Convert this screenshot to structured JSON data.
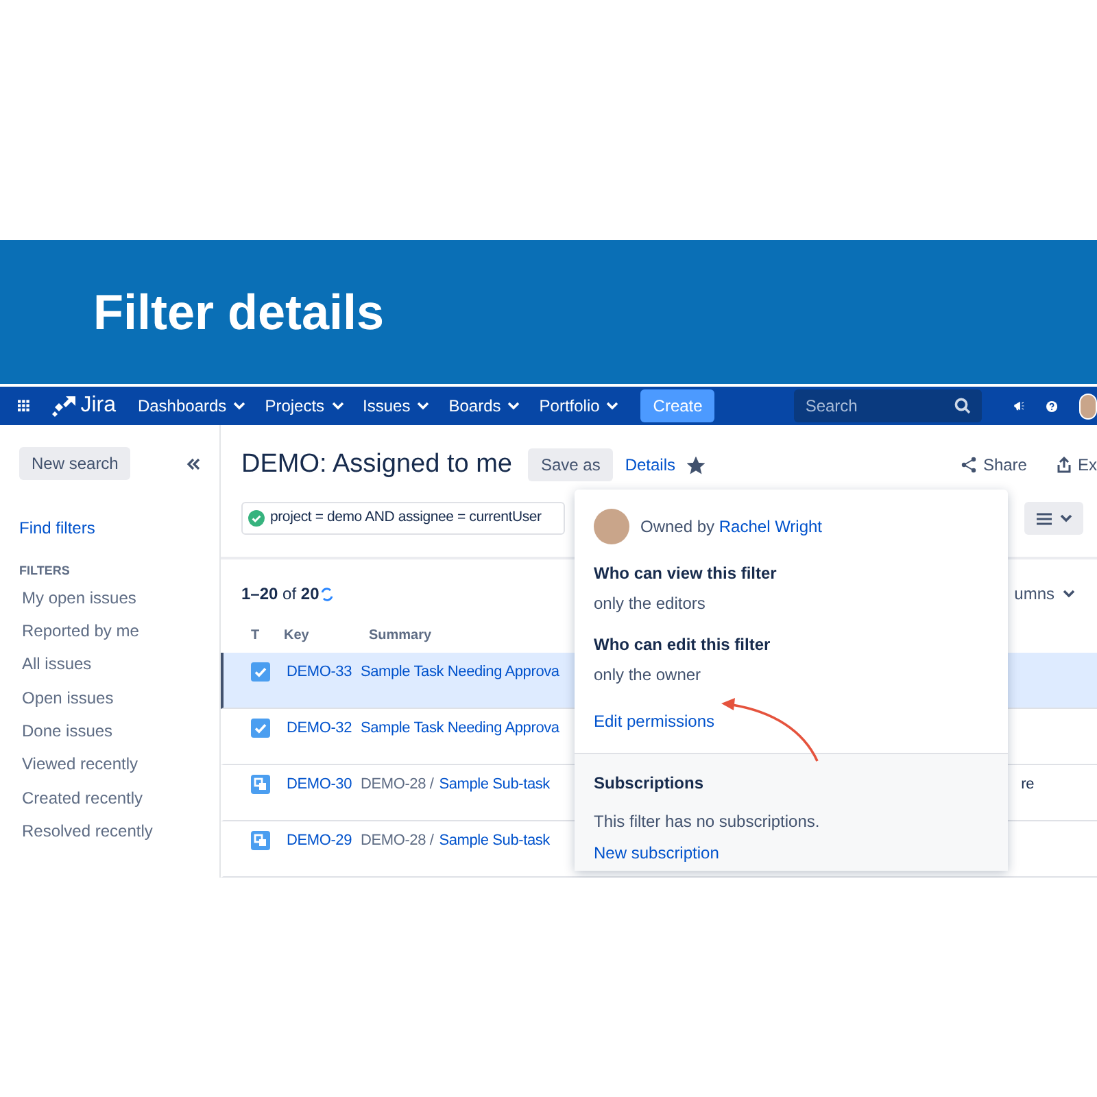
{
  "banner": {
    "title": "Filter details"
  },
  "nav": {
    "logo": "Jira",
    "menus": [
      "Dashboards",
      "Projects",
      "Issues",
      "Boards",
      "Portfolio"
    ],
    "create": "Create",
    "search": {
      "placeholder": "Search"
    }
  },
  "sidebar": {
    "new_search": "New search",
    "find_filters": "Find filters",
    "section": "FILTERS",
    "items": [
      "My open issues",
      "Reported by me",
      "All issues",
      "Open issues",
      "Done issues",
      "Viewed recently",
      "Created recently",
      "Resolved recently"
    ]
  },
  "filter": {
    "title": "DEMO: Assigned to me",
    "save_as": "Save as",
    "details": "Details",
    "starred": true,
    "share": "Share",
    "export": "Ex",
    "query": "project = demo AND assignee = currentUser",
    "query_valid": true
  },
  "results": {
    "count_range": "1–20",
    "count_of": "of",
    "count_total": "20",
    "columns_button": "umns"
  },
  "table": {
    "columns": [
      "T",
      "Key",
      "Summary"
    ],
    "rows": [
      {
        "kind": "task",
        "key": "DEMO-33",
        "summary": "Sample Task Needing Approva",
        "selected": true
      },
      {
        "kind": "task",
        "key": "DEMO-32",
        "summary": "Sample Task Needing Approva",
        "selected": false
      },
      {
        "kind": "subtask",
        "key": "DEMO-30",
        "parent": "DEMO-28 /",
        "summary": "Sample Sub-task",
        "column_4": "re",
        "selected": false
      },
      {
        "kind": "subtask",
        "key": "DEMO-29",
        "parent": "DEMO-28 /",
        "summary": "Sample Sub-task",
        "selected": false
      }
    ]
  },
  "details_popover": {
    "owner_prefix": "Owned by",
    "owner": "Rachel Wright",
    "sections": [
      {
        "heading": "Who can view this filter",
        "value": "only the editors"
      },
      {
        "heading": "Who can edit this filter",
        "value": "only the owner"
      }
    ],
    "edit_link": "Edit permissions",
    "subscriptions": {
      "heading": "Subscriptions",
      "text": "This filter has no subscriptions.",
      "link": "New subscription"
    }
  }
}
